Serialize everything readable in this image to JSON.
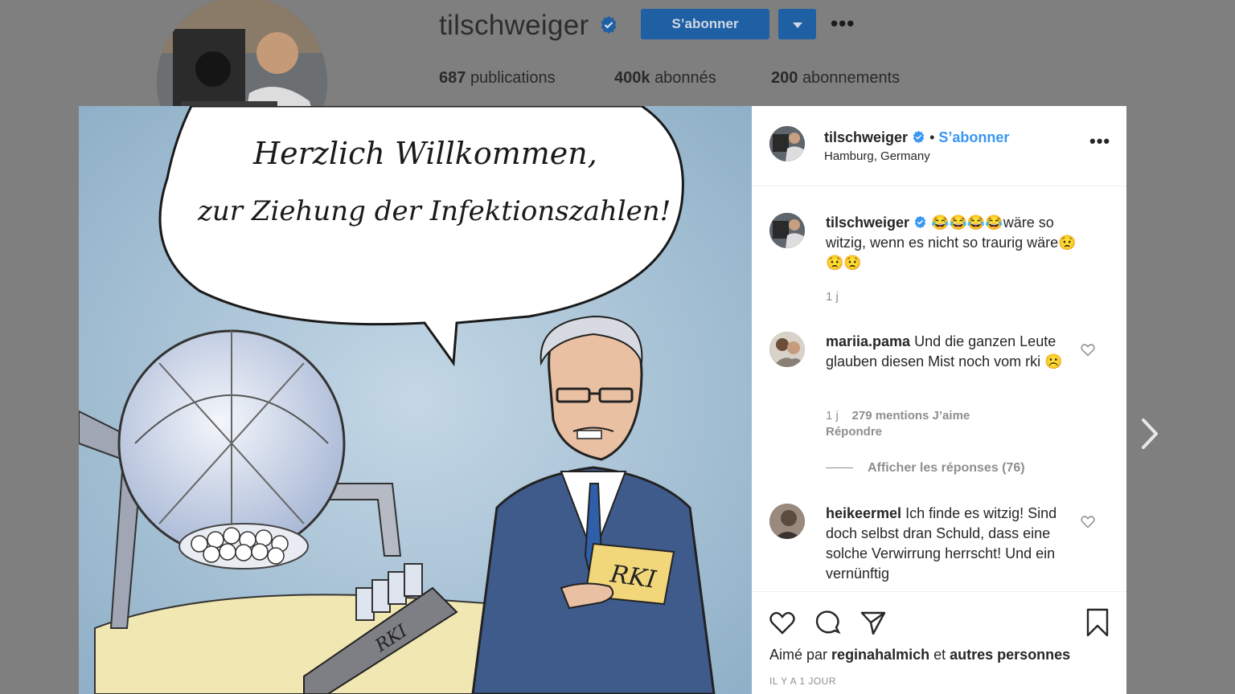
{
  "profile": {
    "username": "tilschweiger",
    "follow_label": "S’abonner",
    "stats": {
      "publications": "687",
      "publications_label": "publications",
      "followers": "400k",
      "followers_label": "abonnés",
      "following": "200",
      "following_label": "abonnements"
    }
  },
  "post": {
    "cartoon_text_line1": "Herzlich Willkommen,",
    "cartoon_text_line2": "zur Ziehung der Infektionszahlen!",
    "card_text": "RKI",
    "machine_text": "RKI",
    "header": {
      "username": "tilschweiger",
      "separator": "•",
      "follow_label": "S’abonner",
      "location": "Hamburg, Germany"
    },
    "caption": {
      "username": "tilschweiger",
      "text": "😂😂😂😂wäre so witzig, wenn es nicht so traurig wäre😟😟😟",
      "time": "1 j"
    },
    "comments": [
      {
        "username": "mariia.pama",
        "text": "Und die ganzen Leute glauben diesen Mist noch vom rki ☹️",
        "time": "1 j",
        "likes": "279 mentions J’aime",
        "reply_label": "Répondre",
        "view_replies": "Afficher les réponses (76)"
      },
      {
        "username": "heikeermel",
        "text": "Ich finde es witzig! Sind doch selbst dran Schuld, dass eine solche Verwirrung herrscht! Und ein vernünftig"
      }
    ],
    "liked_by_prefix": "Aimé par",
    "liked_by_user": "reginahalmich",
    "liked_by_mid": "et",
    "liked_by_suffix": "autres personnes",
    "timestamp": "IL Y A 1 JOUR"
  },
  "colors": {
    "accent": "#3897f0",
    "button_blue": "#1f5fa3",
    "overlay": "#7f7f7f"
  },
  "icons": [
    "verified-badge-icon",
    "chevron-down-icon",
    "more-options-icon",
    "heart-icon",
    "comment-icon",
    "share-icon",
    "bookmark-icon",
    "chevron-right-icon"
  ]
}
